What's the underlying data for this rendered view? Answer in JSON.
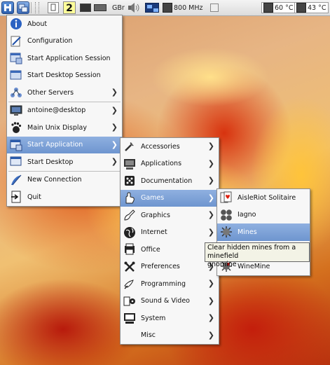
{
  "panel": {
    "workspace_number": "2",
    "keyboard_layout": "GBr",
    "cpu_freq": "800 MHz",
    "temp1": "60 °C",
    "temp2": "43 °C"
  },
  "main_menu": {
    "items": [
      {
        "label": "About",
        "icon": "info-icon"
      },
      {
        "label": "Configuration",
        "icon": "configuration-icon"
      },
      {
        "label": "Start Application Session",
        "icon": "app-session-icon"
      },
      {
        "label": "Start Desktop Session",
        "icon": "desktop-session-icon"
      },
      {
        "label": "Other Servers",
        "icon": "servers-icon"
      },
      {
        "label": "antoine@desktop",
        "icon": "monitor-icon"
      },
      {
        "label": "Main Unix Display",
        "icon": "gnome-foot-icon"
      },
      {
        "label": "Start Application",
        "icon": "window-icon"
      },
      {
        "label": "Start Desktop",
        "icon": "desktop-window-icon"
      },
      {
        "label": "New Connection",
        "icon": "new-connection-icon"
      },
      {
        "label": "Quit",
        "icon": "quit-icon"
      }
    ]
  },
  "apps_menu": {
    "items": [
      {
        "label": "Accessories",
        "icon": "accessories-icon"
      },
      {
        "label": "Applications",
        "icon": "applications-icon"
      },
      {
        "label": "Documentation",
        "icon": "documentation-icon"
      },
      {
        "label": "Games",
        "icon": "games-icon"
      },
      {
        "label": "Graphics",
        "icon": "graphics-icon"
      },
      {
        "label": "Internet",
        "icon": "internet-icon"
      },
      {
        "label": "Office",
        "icon": "office-icon"
      },
      {
        "label": "Preferences",
        "icon": "preferences-icon"
      },
      {
        "label": "Programming",
        "icon": "programming-icon"
      },
      {
        "label": "Sound & Video",
        "icon": "sound-video-icon"
      },
      {
        "label": "System",
        "icon": "system-icon"
      },
      {
        "label": "Misc",
        "icon": ""
      }
    ]
  },
  "games_menu": {
    "items": [
      {
        "label": "AisleRiot Solitaire",
        "icon": "cards-icon"
      },
      {
        "label": "Iagno",
        "icon": "iagno-icon"
      },
      {
        "label": "Mines",
        "icon": "mine-icon"
      },
      {
        "label": "WineMine",
        "icon": "winemine-icon"
      }
    ]
  },
  "tooltip": {
    "line1": "Clear hidden mines from a minefield",
    "line2": "gnomine"
  },
  "colors": {
    "selection": "#7d9fd6",
    "menu_bg": "#f7f7f7"
  }
}
